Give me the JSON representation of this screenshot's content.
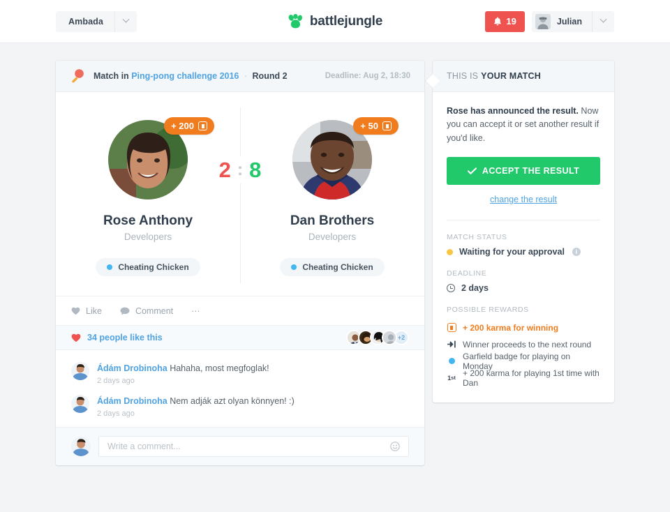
{
  "topbar": {
    "org_name": "Ambada",
    "org_caret_icon": "chevron-down-icon",
    "brand_name": "battlejungle",
    "brand_logo_icon": "paw-logo-icon",
    "notification_icon": "bell-icon",
    "notification_count": "19",
    "user_name": "Julian",
    "user_caret_icon": "chevron-down-icon"
  },
  "match": {
    "head": {
      "sport_icon": "ping-pong-paddle-icon",
      "prefix": "Match in",
      "challenge": "Ping-pong challenge 2016",
      "separator": "·",
      "round": "Round 2",
      "deadline": "Deadline: Aug 2, 18:30"
    },
    "score": {
      "left": "2",
      "colon": ":",
      "right": "8"
    },
    "players": [
      {
        "name": "Rose Anthony",
        "team": "Developers",
        "karma": "+ 200",
        "karma_icon": "karma-icon",
        "badge": "Cheating Chicken",
        "badge_dot_color": "#41b6f0",
        "avatar_name": "avatar-rose"
      },
      {
        "name": "Dan Brothers",
        "team": "Developers",
        "karma": "+ 50",
        "karma_icon": "karma-icon",
        "badge": "Cheating Chicken",
        "badge_dot_color": "#41b6f0",
        "avatar_name": "avatar-dan"
      }
    ],
    "actions": {
      "like_icon": "heart-icon",
      "like_label": "Like",
      "comment_icon": "speech-bubble-icon",
      "comment_label": "Comment",
      "more_label": "···"
    },
    "likes": {
      "heart_icon": "heart-filled-icon",
      "text": "34 people like this",
      "more_count": "+2"
    },
    "comments": [
      {
        "author": "Ádám Drobinoha",
        "text": "Hahaha, most megfoglak!",
        "time": "2 days ago"
      },
      {
        "author": "Ádám Drobinoha",
        "text": "Nem adják azt olyan könnyen! :)",
        "time": "2 days ago"
      }
    ],
    "compose": {
      "placeholder": "Write a comment...",
      "emoji_icon": "smiley-icon"
    }
  },
  "side": {
    "head_prefix": "THIS IS",
    "head_strong": "YOUR MATCH",
    "announce_strong": "Rose has announced the result.",
    "announce_rest": " Now you can accept it or set another result if you'd like.",
    "accept_icon": "check-icon",
    "accept_label": "ACCEPT THE RESULT",
    "change_link": "change the result",
    "status_label": "MATCH STATUS",
    "status_value": "Waiting for your approval",
    "status_dot_color": "#f7c744",
    "status_info_icon": "info-icon",
    "deadline_label": "DEADLINE",
    "deadline_icon": "clock-icon",
    "deadline_value": "2 days",
    "rewards_label": "POSSIBLE REWARDS",
    "rewards": [
      {
        "icon": "karma-icon",
        "text": "+ 200 karma for winning",
        "highlight": true
      },
      {
        "icon": "arrow-into-door-icon",
        "text": "Winner proceeds to the next round",
        "highlight": false
      },
      {
        "icon": "blue-dot-badge-icon",
        "text": "Garfield badge for playing on Monday",
        "highlight": false
      },
      {
        "icon": "first-time-icon",
        "text": "+ 200 karma for playing 1st time with Dan",
        "highlight": false
      }
    ]
  },
  "colors": {
    "accent_green": "#22c96b",
    "accent_orange": "#f07c1e",
    "accent_red": "#ef5350",
    "accent_blue": "#4fa3e3",
    "accent_yellow": "#f7c744"
  }
}
